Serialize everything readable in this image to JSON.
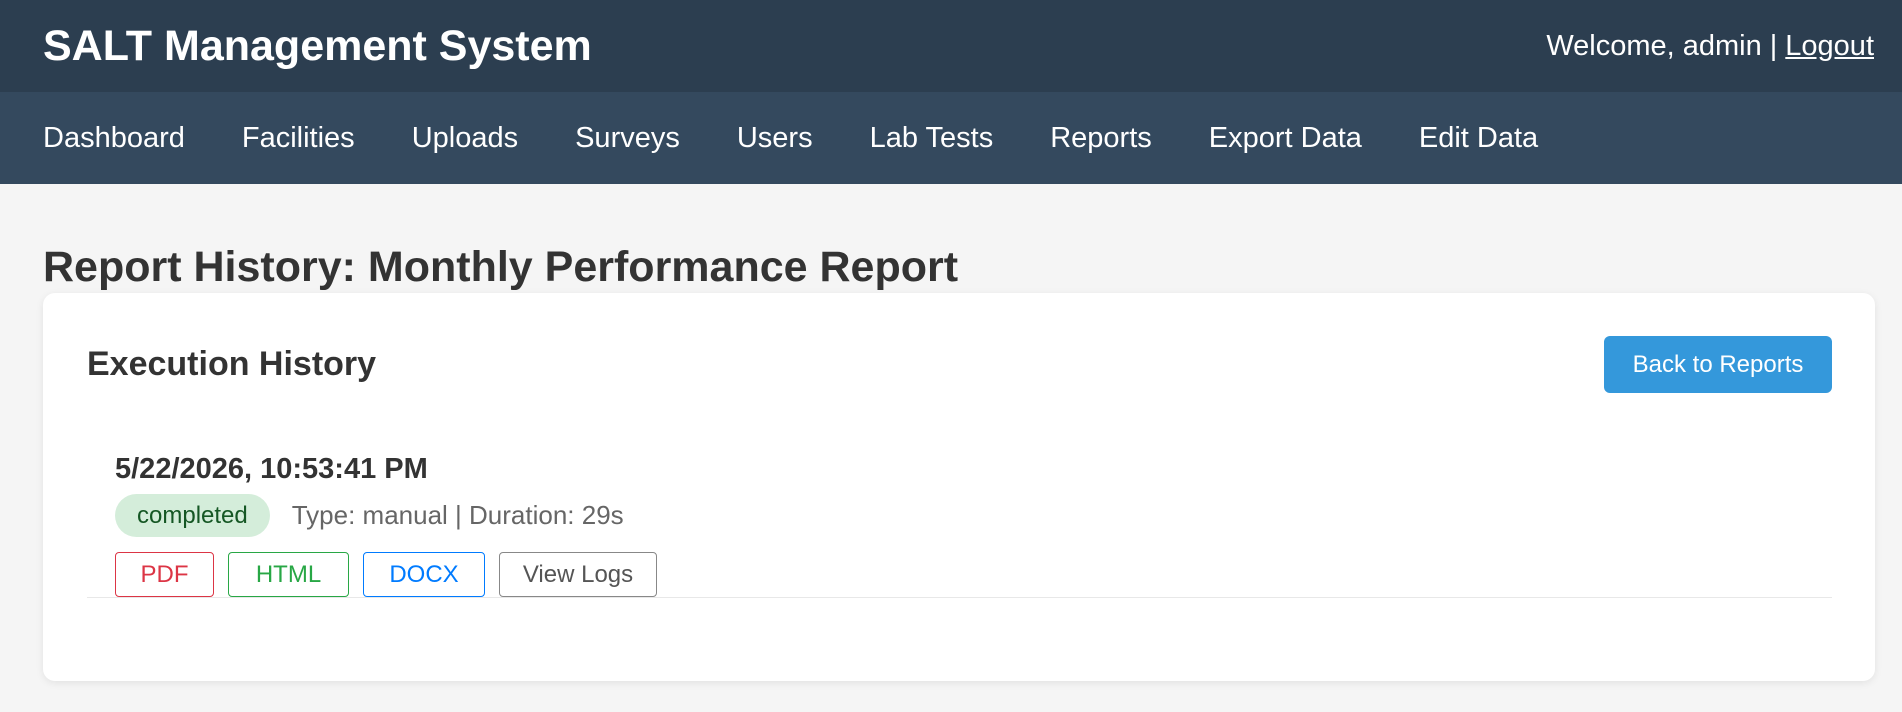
{
  "header": {
    "app_title": "SALT Management System",
    "welcome_text": "Welcome, admin",
    "separator": "|",
    "logout_label": "Logout"
  },
  "nav": {
    "items": [
      "Dashboard",
      "Facilities",
      "Uploads",
      "Surveys",
      "Users",
      "Lab Tests",
      "Reports",
      "Export Data",
      "Edit Data"
    ]
  },
  "page": {
    "title": "Report History: Monthly Performance Report"
  },
  "card": {
    "title": "Execution History",
    "back_button_label": "Back to Reports"
  },
  "history": [
    {
      "datetime": "5/22/2026, 10:53:41 PM",
      "status": "completed",
      "meta": "Type: manual | Duration: 29s",
      "actions": {
        "pdf": "PDF",
        "html": "HTML",
        "docx": "DOCX",
        "logs": "View Logs"
      }
    }
  ],
  "colors": {
    "header_bg": "#2c3e50",
    "nav_bg": "#34495e",
    "accent": "#3498db",
    "status_completed_bg": "#d4edda",
    "status_completed_text": "#155724",
    "pdf": "#dc3545",
    "html": "#28a745",
    "docx": "#007bff"
  }
}
